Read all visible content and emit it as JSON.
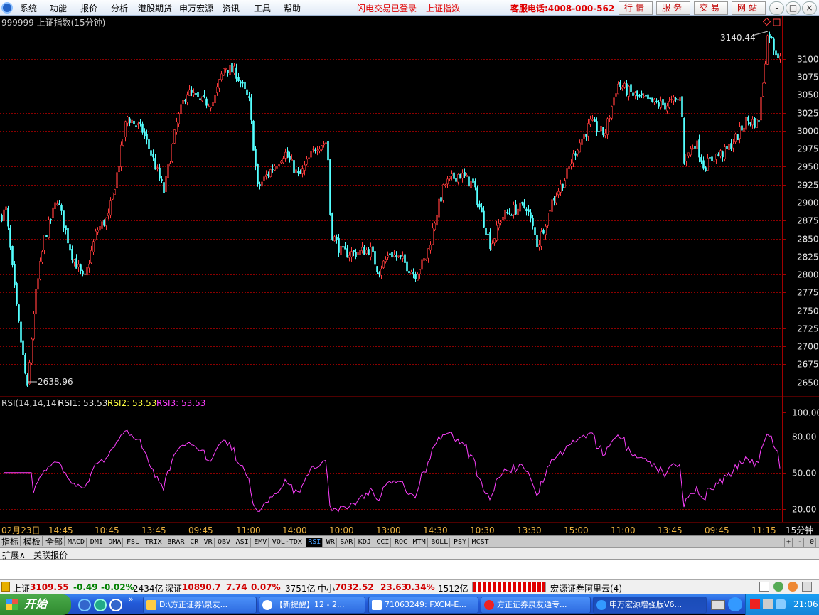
{
  "menu": {
    "items": [
      "系统",
      "功能",
      "报价",
      "分析",
      "港股期货",
      "申万宏源",
      "资讯",
      "工具",
      "帮助"
    ],
    "notices": [
      "闪电交易已登录",
      "上证指数"
    ],
    "hotline": "客服电话:4008-000-562",
    "buttons": [
      "行情",
      "服务",
      "交易",
      "网站"
    ]
  },
  "window_controls": [
    "-",
    "□",
    "×"
  ],
  "chart_title": "999999 上证指数(15分钟)",
  "price": {
    "high_label": "3140.44",
    "low_label": "2638.96",
    "yticks": [
      3100,
      3075,
      3050,
      3025,
      3000,
      2975,
      2950,
      2925,
      2900,
      2875,
      2850,
      2825,
      2800,
      2775,
      2750,
      2725,
      2700,
      2675,
      2650
    ],
    "ymin": 2630,
    "ymax": 3160
  },
  "rsi": {
    "label": "RSI(14,14,14)",
    "rsi1": "RSI1: 53.53",
    "rsi2": "RSI2: 53.53",
    "rsi3": "RSI3: 53.53",
    "yticks": [
      "100.00",
      "80.00",
      "50.00",
      "20.00"
    ]
  },
  "xaxis": {
    "labels": [
      "02月23日",
      "14:45",
      "10:45",
      "13:45",
      "09:45",
      "11:00",
      "14:00",
      "10:00",
      "13:00",
      "14:30",
      "10:30",
      "13:30",
      "15:00",
      "11:00",
      "13:45",
      "09:45",
      "11:15"
    ],
    "period": "15分钟"
  },
  "chart_data": {
    "type": "candlestick",
    "title": "999999 上证指数(15分钟)",
    "price_keypoints": [
      [
        0,
        2880
      ],
      [
        8,
        2890
      ],
      [
        22,
        2760
      ],
      [
        38,
        2638.96
      ],
      [
        48,
        2760
      ],
      [
        62,
        2850
      ],
      [
        80,
        2905
      ],
      [
        100,
        2830
      ],
      [
        118,
        2790
      ],
      [
        135,
        2860
      ],
      [
        152,
        2880
      ],
      [
        168,
        2960
      ],
      [
        178,
        3020
      ],
      [
        200,
        3000
      ],
      [
        215,
        2960
      ],
      [
        230,
        2915
      ],
      [
        248,
        3010
      ],
      [
        262,
        3055
      ],
      [
        282,
        3040
      ],
      [
        300,
        3040
      ],
      [
        315,
        3090
      ],
      [
        332,
        3080
      ],
      [
        350,
        3040
      ],
      [
        362,
        2920
      ],
      [
        380,
        2945
      ],
      [
        400,
        2970
      ],
      [
        420,
        2935
      ],
      [
        445,
        2980
      ],
      [
        460,
        2985
      ],
      [
        465,
        2860
      ],
      [
        480,
        2830
      ],
      [
        500,
        2830
      ],
      [
        520,
        2835
      ],
      [
        532,
        2805
      ],
      [
        548,
        2830
      ],
      [
        565,
        2820
      ],
      [
        583,
        2800
      ],
      [
        600,
        2825
      ],
      [
        612,
        2880
      ],
      [
        625,
        2925
      ],
      [
        645,
        2940
      ],
      [
        665,
        2925
      ],
      [
        678,
        2880
      ],
      [
        690,
        2840
      ],
      [
        705,
        2880
      ],
      [
        722,
        2890
      ],
      [
        740,
        2895
      ],
      [
        756,
        2840
      ],
      [
        775,
        2900
      ],
      [
        795,
        2935
      ],
      [
        810,
        2975
      ],
      [
        830,
        3010
      ],
      [
        850,
        2995
      ],
      [
        868,
        3065
      ],
      [
        890,
        3050
      ],
      [
        912,
        3040
      ],
      [
        935,
        3035
      ],
      [
        958,
        3045
      ],
      [
        962,
        2960
      ],
      [
        978,
        2985
      ],
      [
        990,
        2950
      ],
      [
        1005,
        2965
      ],
      [
        1020,
        2970
      ],
      [
        1035,
        2990
      ],
      [
        1050,
        3015
      ],
      [
        1066,
        3010
      ],
      [
        1072,
        3060
      ],
      [
        1080,
        3140.44
      ],
      [
        1090,
        3110
      ],
      [
        1100,
        3105
      ]
    ],
    "rsi_range": [
      0,
      100
    ],
    "rsi_last": 53.53
  },
  "indicator_tabs": {
    "cats": [
      "指标",
      "模板",
      "全部"
    ],
    "items": [
      "MACD",
      "DMI",
      "DMA",
      "FSL",
      "TRIX",
      "BRAR",
      "CR",
      "VR",
      "OBV",
      "ASI",
      "EMV",
      "VOL-TDX",
      "RSI",
      "WR",
      "SAR",
      "KDJ",
      "CCI",
      "ROC",
      "MTM",
      "BOLL",
      "PSY",
      "MCST"
    ],
    "active": "RSI",
    "nav": [
      "+",
      "-",
      "0"
    ]
  },
  "ext_tabs": [
    "扩展∧",
    "关联报价"
  ],
  "status": {
    "sh_name": "上证",
    "sh_value": "3109.55",
    "sh_change": "-0.49",
    "sh_pct": "-0.02%",
    "sh_vol": "2434亿",
    "sz_name": "深证",
    "sz_value": "10890.7",
    "sz_change": "7.74",
    "sz_pct": "0.07%",
    "sz_vol": "3751亿",
    "zx_name": "中小",
    "zx_value": "7032.52",
    "zx_change": "23.63",
    "zx_pct": "0.34%",
    "zx_vol": "1512亿",
    "server": "宏源证券阿里云(4)"
  },
  "taskbar": {
    "start": "开始",
    "tasks": [
      "D:\\方正证券\\泉友...",
      "【新提醒】12 - 2...",
      "71063249: FXCM-E...",
      "方正证券泉友通专...",
      "申万宏源增强版V6..."
    ],
    "time": "21:06"
  },
  "colors": {
    "up": "#ff3c3c",
    "down": "#54ffff",
    "rsi": "#ff40ff",
    "grid": "#8b0000",
    "axis": "#a00000"
  }
}
